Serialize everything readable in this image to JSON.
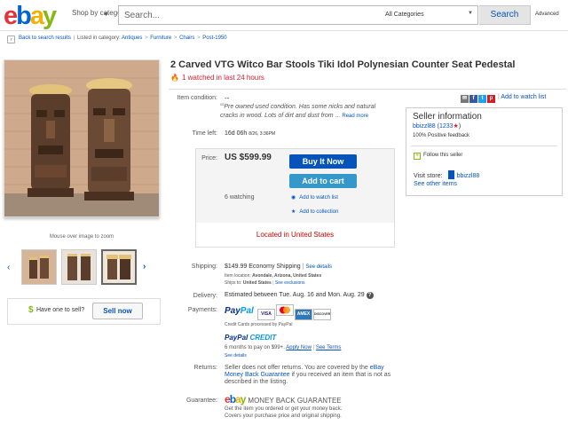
{
  "header": {
    "logo": "ebay",
    "shop_by": "Shop by category",
    "search_placeholder": "Search...",
    "category": "All Categories",
    "search_button": "Search",
    "advanced": "Advanced"
  },
  "breadcrumb": {
    "back": "Back to search results",
    "listed_in": "Listed in category:",
    "items": [
      "Antiques",
      "Furniture",
      "Chairs",
      "Post-1950"
    ]
  },
  "gallery": {
    "mouse_hint": "Mouse over image to zoom",
    "thumb_count": 3
  },
  "sell": {
    "question": "Have one to sell?",
    "button": "Sell now"
  },
  "item": {
    "title": "2 Carved VTG Witco Bar Stools Tiki Idol Polynesian Counter Seat Pedestal",
    "watched": "1 watched in last 24 hours",
    "condition_label": "Item condition:",
    "condition_value": "--",
    "condition_desc": "Pre owned used condition. Has some nicks and natural cracks in wood. Lots of dirt and dust from",
    "read_more": "Read more",
    "time_left_label": "Time left:",
    "time_left_value": "16d 06h",
    "time_left_date": "8/26, 3:36PM"
  },
  "share": {
    "add_watch": "Add to watch list"
  },
  "seller": {
    "title": "Seller information",
    "name": "bbizzl88",
    "score": "(1233",
    "score_end": ")",
    "feedback": "100% Positive feedback",
    "follow": "Follow this seller",
    "visit_store": "Visit store:",
    "store_name": "bbizzl88",
    "other_items": "See other items"
  },
  "purchase": {
    "price_label": "Price:",
    "price": "US $599.99",
    "buy_now": "Buy It Now",
    "add_to_cart": "Add to cart",
    "watching": "6 watching",
    "add_watch": "Add to watch list",
    "add_collection": "Add to collection",
    "located": "Located in United States"
  },
  "shipping": {
    "label": "Shipping:",
    "cost": "$149.99",
    "service": "Economy Shipping",
    "see_details": "See details",
    "location_label": "Item location:",
    "location": "Avondale, Arizona, United States",
    "ships_to_label": "Ships to:",
    "ships_to": "United States",
    "see_exclusions": "See exclusions",
    "delivery_label": "Delivery:",
    "delivery": "Estimated between Tue. Aug. 16 and Mon. Aug. 29"
  },
  "payments": {
    "label": "Payments:",
    "paypal_1": "Pay",
    "paypal_2": "Pal",
    "cards": [
      "VISA",
      "MC",
      "AMEX",
      "DISCOVER"
    ],
    "cc_processed": "Credit Cards processed by PayPal",
    "credit_1": "PayPal ",
    "credit_2": "CREDIT",
    "terms": "6 months to pay on $99+.",
    "apply_now": "Apply Now",
    "see_terms": "See Terms",
    "see_details": "See details"
  },
  "returns": {
    "label": "Returns:",
    "text_1": "Seller does not offer returns. You are covered by the",
    "guarantee_link": "eBay Money Back Guarantee",
    "text_2": "if you received an item that is not as described in the listing."
  },
  "guarantee": {
    "label": "Guarantee:",
    "logo_text": "MONEY BACK GUARANTEE",
    "text_1": "Get the item you ordered or get your money back.",
    "text_2": "Covers your purchase price and original shipping."
  },
  "colors": {
    "ebay_red": "#e53238",
    "ebay_blue": "#0064d2",
    "ebay_yellow": "#f5af02",
    "ebay_green": "#86b817",
    "link": "#0654ba",
    "buy_button": "#0654ba",
    "cart_button": "#3498ca",
    "alert": "#dd1e31"
  }
}
